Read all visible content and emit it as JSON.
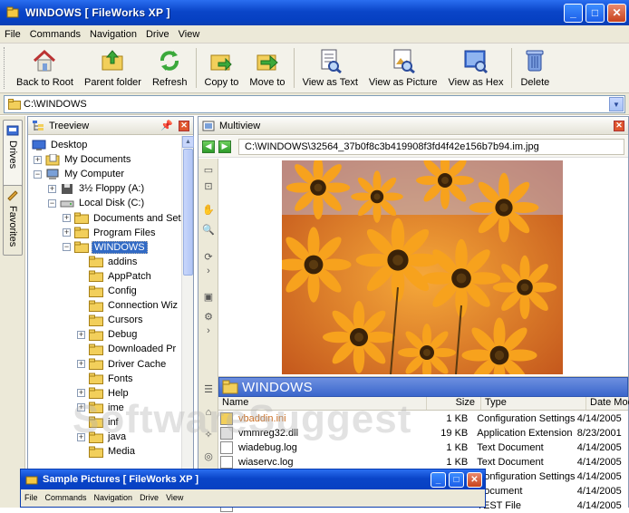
{
  "window": {
    "title": "WINDOWS  [ FileWorks XP ]",
    "min": "_",
    "max": "□",
    "close": "✕"
  },
  "menu": [
    "File",
    "Commands",
    "Navigation",
    "Drive",
    "View"
  ],
  "toolbar": [
    {
      "label": "Back to Root",
      "icon": "home-icon"
    },
    {
      "label": "Parent folder",
      "icon": "parent-folder-icon"
    },
    {
      "label": "Refresh",
      "icon": "refresh-icon"
    },
    {
      "label": "Copy to",
      "icon": "copy-to-icon"
    },
    {
      "label": "Move to",
      "icon": "move-to-icon"
    },
    {
      "label": "View as Text",
      "icon": "view-text-icon"
    },
    {
      "label": "View as Picture",
      "icon": "view-picture-icon"
    },
    {
      "label": "View as Hex",
      "icon": "view-hex-icon"
    },
    {
      "label": "Delete",
      "icon": "delete-icon"
    }
  ],
  "address": {
    "value": "C:\\WINDOWS"
  },
  "sidetabs": {
    "drives": "Drives",
    "favorites": "Favorites"
  },
  "treeview": {
    "title": "Treeview",
    "items": [
      {
        "label": "Desktop",
        "level": 0
      },
      {
        "label": "My Documents",
        "level": 1
      },
      {
        "label": "My Computer",
        "level": 1
      },
      {
        "label": "3½ Floppy (A:)",
        "level": 2
      },
      {
        "label": "Local Disk (C:)",
        "level": 2
      },
      {
        "label": "Documents and Set",
        "level": 3
      },
      {
        "label": "Program Files",
        "level": 3
      },
      {
        "label": "WINDOWS",
        "level": 3,
        "selected": true
      },
      {
        "label": "addins",
        "level": 4
      },
      {
        "label": "AppPatch",
        "level": 4
      },
      {
        "label": "Config",
        "level": 4
      },
      {
        "label": "Connection Wiz",
        "level": 4
      },
      {
        "label": "Cursors",
        "level": 4
      },
      {
        "label": "Debug",
        "level": 4
      },
      {
        "label": "Downloaded Pr",
        "level": 4
      },
      {
        "label": "Driver Cache",
        "level": 4
      },
      {
        "label": "Fonts",
        "level": 4
      },
      {
        "label": "Help",
        "level": 4
      },
      {
        "label": "ime",
        "level": 4
      },
      {
        "label": "inf",
        "level": 4
      },
      {
        "label": "java",
        "level": 4
      },
      {
        "label": "Media",
        "level": 4
      }
    ]
  },
  "multiview": {
    "title": "Multiview",
    "path": "C:\\WINDOWS\\32564_37b0f8c3b419908f3fd4f42e156b7b94.im.jpg",
    "image_alt": "Orange daisy flowers"
  },
  "filelist": {
    "folder": "WINDOWS",
    "columns": [
      "Name",
      "Size",
      "Type",
      "Date Modified"
    ],
    "rows": [
      {
        "name": "vbaddin.ini",
        "size": "1 KB",
        "type": "Configuration Settings",
        "date": "4/14/2005"
      },
      {
        "name": "vmmreg32.dll",
        "size": "19 KB",
        "type": "Application Extension",
        "date": "8/23/2001"
      },
      {
        "name": "wiadebug.log",
        "size": "1 KB",
        "type": "Text Document",
        "date": "4/14/2005"
      },
      {
        "name": "wiaservc.log",
        "size": "1 KB",
        "type": "Text Document",
        "date": "4/14/2005"
      },
      {
        "name": "",
        "size": "",
        "type": "Configuration Settings",
        "date": "4/14/2005"
      },
      {
        "name": "",
        "size": "",
        "type": "Document",
        "date": "4/14/2005"
      },
      {
        "name": "",
        "size": "",
        "type": "TEST File",
        "date": "4/14/2005"
      }
    ]
  },
  "watermark": "SoftwareSuggest",
  "subwindow": {
    "title": "Sample Pictures  [ FileWorks XP ]",
    "menu": [
      "File",
      "Commands",
      "Navigation",
      "Drive",
      "View"
    ]
  }
}
